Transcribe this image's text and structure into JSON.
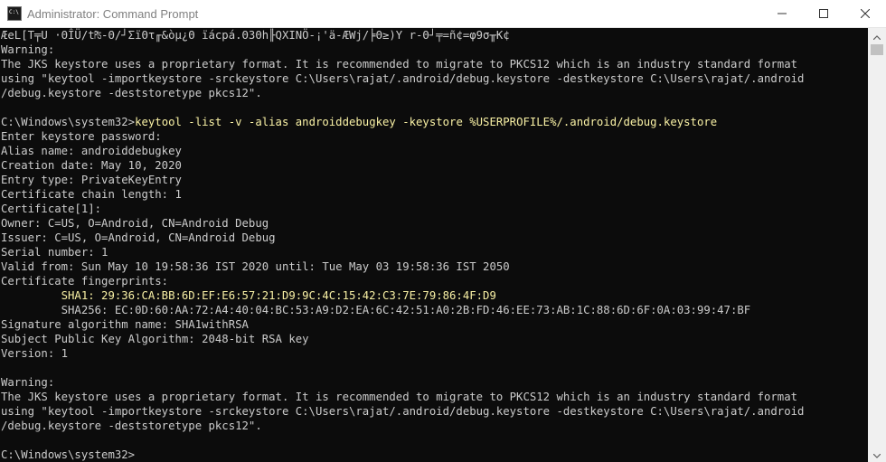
{
  "window": {
    "title": "Administrator: Command Prompt",
    "icon": "cmd-icon"
  },
  "controls": {
    "minimize": "minimize-icon",
    "maximize": "maximize-icon",
    "close": "close-icon"
  },
  "colors": {
    "background": "#0c0c0c",
    "text": "#cccccc",
    "highlight": "#f9f1a5"
  },
  "console": {
    "lines": [
      {
        "text": "ÆeL[T╤U ·ΘÎÜ/t₧-Θ/┘ΣïΘτ╓&òµ¿Θ ïácpá.Θ3Θh╟QXINÖ-¡'ä-ÆWj/╞Θ≥)Y r-Θ┘╤=ñ¢=φ9σ╥K¢",
        "hl": false
      },
      {
        "text": "Warning:",
        "hl": false
      },
      {
        "text": "The JKS keystore uses a proprietary format. It is recommended to migrate to PKCS12 which is an industry standard format",
        "hl": false
      },
      {
        "text": "using \"keytool -importkeystore -srckeystore C:\\Users\\rajat/.android/debug.keystore -destkeystore C:\\Users\\rajat/.android",
        "hl": false
      },
      {
        "text": "/debug.keystore -deststoretype pkcs12\".",
        "hl": false
      },
      {
        "text": "",
        "hl": false
      },
      {
        "prompt": "C:\\Windows\\system32>",
        "command": "keytool -list -v -alias androiddebugkey -keystore %USERPROFILE%/.android/debug.keystore"
      },
      {
        "text": "Enter keystore password:",
        "hl": false
      },
      {
        "text": "Alias name: androiddebugkey",
        "hl": false
      },
      {
        "text": "Creation date: May 10, 2020",
        "hl": false
      },
      {
        "text": "Entry type: PrivateKeyEntry",
        "hl": false
      },
      {
        "text": "Certificate chain length: 1",
        "hl": false
      },
      {
        "text": "Certificate[1]:",
        "hl": false
      },
      {
        "text": "Owner: C=US, O=Android, CN=Android Debug",
        "hl": false
      },
      {
        "text": "Issuer: C=US, O=Android, CN=Android Debug",
        "hl": false
      },
      {
        "text": "Serial number: 1",
        "hl": false
      },
      {
        "text": "Valid from: Sun May 10 19:58:36 IST 2020 until: Tue May 03 19:58:36 IST 2050",
        "hl": false
      },
      {
        "text": "Certificate fingerprints:",
        "hl": false
      },
      {
        "text": "         SHA1: 29:36:CA:BB:6D:EF:E6:57:21:D9:9C:4C:15:42:C3:7E:79:86:4F:D9",
        "hl": true
      },
      {
        "text": "         SHA256: EC:0D:60:AA:72:A4:40:04:BC:53:A9:D2:EA:6C:42:51:A0:2B:FD:46:EE:73:AB:1C:88:6D:6F:0A:03:99:47:BF",
        "hl": false
      },
      {
        "text": "Signature algorithm name: SHA1withRSA",
        "hl": false
      },
      {
        "text": "Subject Public Key Algorithm: 2048-bit RSA key",
        "hl": false
      },
      {
        "text": "Version: 1",
        "hl": false
      },
      {
        "text": "",
        "hl": false
      },
      {
        "text": "Warning:",
        "hl": false
      },
      {
        "text": "The JKS keystore uses a proprietary format. It is recommended to migrate to PKCS12 which is an industry standard format",
        "hl": false
      },
      {
        "text": "using \"keytool -importkeystore -srckeystore C:\\Users\\rajat/.android/debug.keystore -destkeystore C:\\Users\\rajat/.android",
        "hl": false
      },
      {
        "text": "/debug.keystore -deststoretype pkcs12\".",
        "hl": false
      },
      {
        "text": "",
        "hl": false
      },
      {
        "text": "C:\\Windows\\system32>",
        "hl": false
      }
    ]
  }
}
